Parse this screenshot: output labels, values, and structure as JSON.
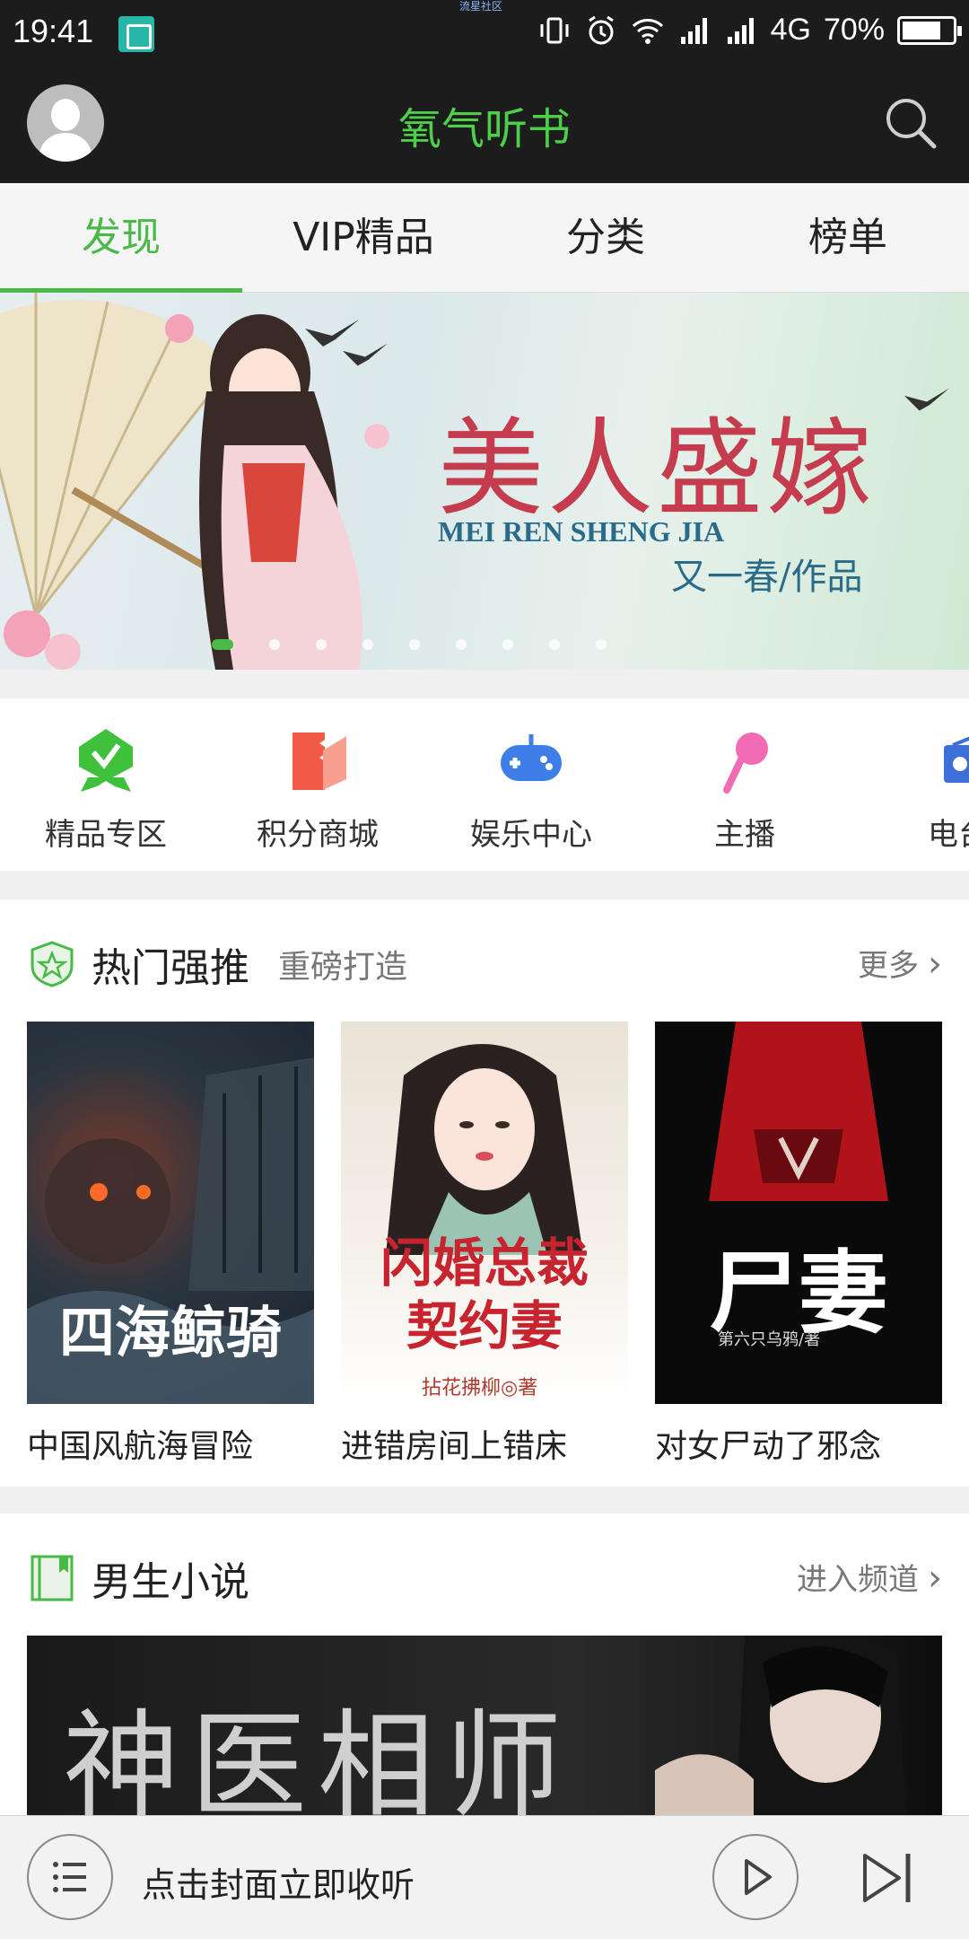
{
  "status_bar": {
    "time": "19:41",
    "tiny_label": "流星社区",
    "network": "4G",
    "battery": "70%",
    "icons": [
      "vibrate-icon",
      "alarm-icon",
      "wifi-icon",
      "signal-icon",
      "signal-icon",
      "battery-icon"
    ]
  },
  "header": {
    "title": "氧气听书",
    "avatar_icon": "avatar-icon",
    "search_icon": "search-icon"
  },
  "tabs": [
    {
      "label": "发现",
      "active": true
    },
    {
      "label": "VIP精品",
      "active": false
    },
    {
      "label": "分类",
      "active": false
    },
    {
      "label": "榜单",
      "active": false
    }
  ],
  "banner": {
    "title": "美人盛嫁",
    "subtitle": "MEI REN SHENG JIA",
    "author": "又一春/作品",
    "slide_count": 9,
    "active_slide": 0
  },
  "quick_entries": [
    {
      "label": "精品专区",
      "icon": "badge-icon",
      "color": "#3fc13d"
    },
    {
      "label": "积分商城",
      "icon": "ticket-icon",
      "color": "#f05a46"
    },
    {
      "label": "娱乐中心",
      "icon": "gamepad-icon",
      "color": "#3d7ee8"
    },
    {
      "label": "主播",
      "icon": "microphone-icon",
      "color": "#f06ab4"
    },
    {
      "label": "电台",
      "icon": "radio-icon",
      "color": "#3d6fd8"
    }
  ],
  "hot_section": {
    "title": "热门强推",
    "subtitle": "重磅打造",
    "more": "更多",
    "books": [
      {
        "title": "中国风航海冒险",
        "cover_text": "四海鲸骑"
      },
      {
        "title": "进错房间上错床",
        "cover_text": "闪婚总裁契约妻",
        "cover_author": "拈花拂柳◎著"
      },
      {
        "title": "对女尸动了邪念",
        "cover_text": "尸妻",
        "cover_author": "第六只乌鸦/著"
      }
    ]
  },
  "male_section": {
    "title": "男生小说",
    "more": "进入频道",
    "banner_text": "神医相师"
  },
  "player": {
    "prompt": "点击封面立即收听",
    "list_icon": "list-icon",
    "play_icon": "play-icon",
    "next_icon": "skip-next-icon"
  },
  "colors": {
    "accent": "#49b947",
    "header_bg": "#1c1c1c"
  }
}
